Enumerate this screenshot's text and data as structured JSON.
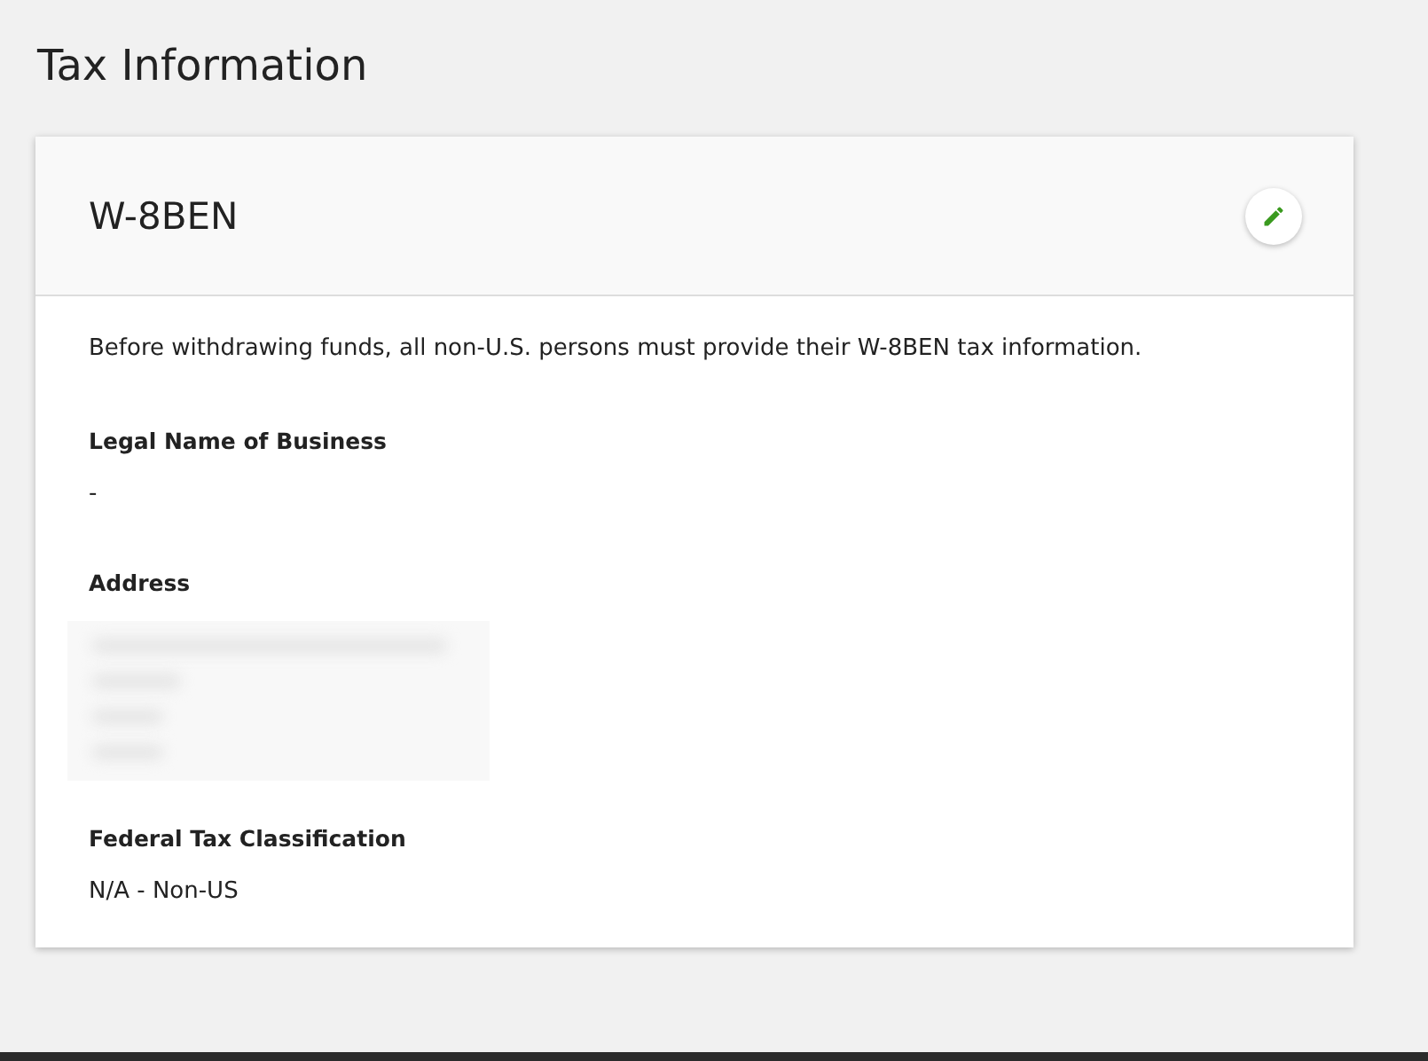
{
  "page_title": "Tax Information",
  "card": {
    "title": "W-8BEN",
    "intro": "Before withdrawing funds, all non-U.S. persons must provide their W-8BEN tax information.",
    "fields": [
      {
        "label": "Legal Name of Business",
        "kind": "text",
        "value": "-"
      },
      {
        "label": "Address",
        "kind": "redacted"
      },
      {
        "label": "Federal Tax Classification",
        "kind": "text",
        "value": "N/A - Non-US"
      }
    ]
  }
}
